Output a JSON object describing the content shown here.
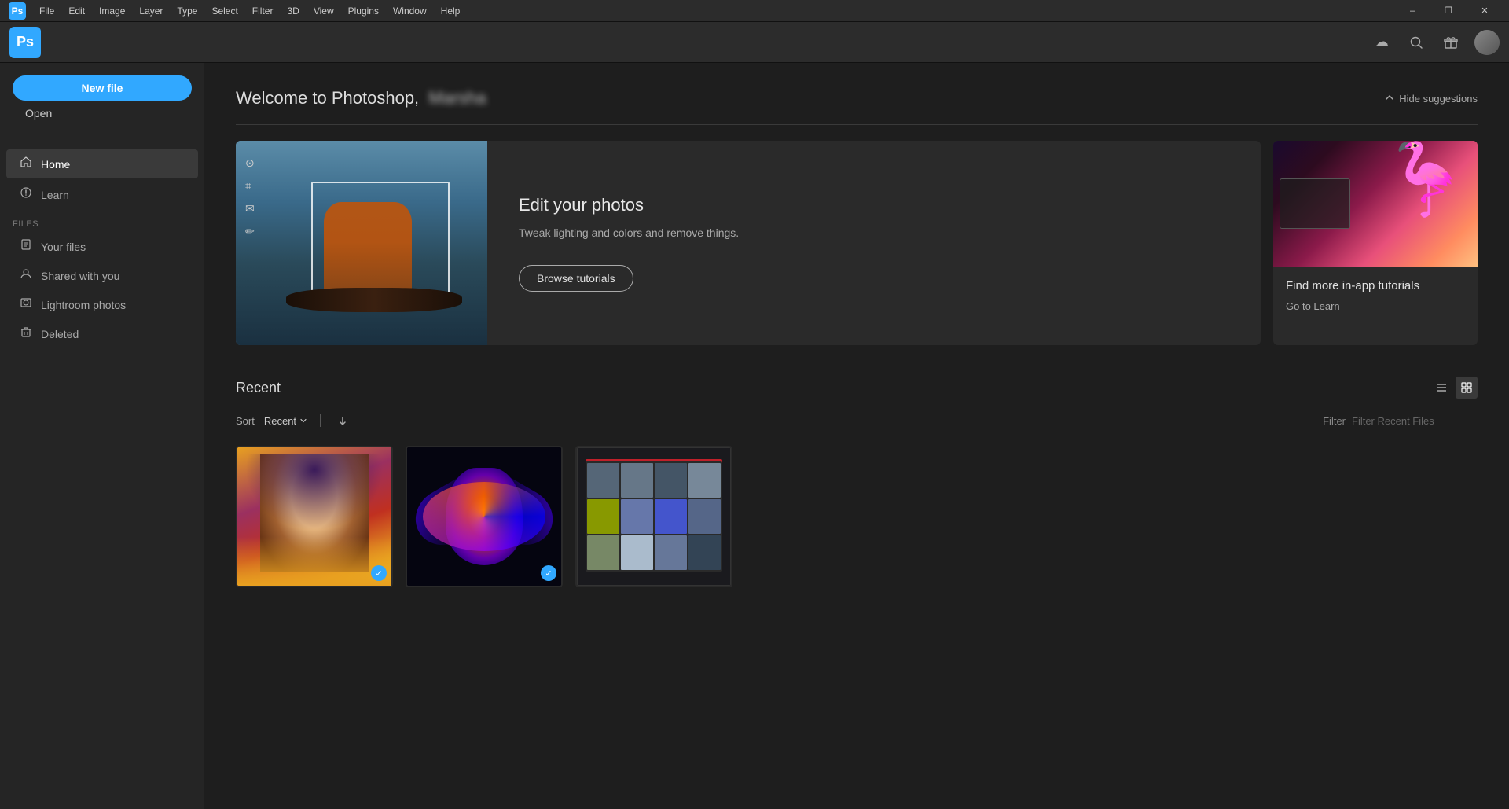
{
  "menubar": {
    "logo": "Ps",
    "items": [
      "File",
      "Edit",
      "Image",
      "Layer",
      "Type",
      "Select",
      "Filter",
      "3D",
      "View",
      "Plugins",
      "Window",
      "Help"
    ],
    "window_controls": [
      "–",
      "❐",
      "✕"
    ]
  },
  "topbar": {
    "logo": "Ps",
    "cloud_icon": "☁",
    "search_icon": "🔍",
    "gift_icon": "🎁"
  },
  "sidebar": {
    "new_file_label": "New file",
    "open_label": "Open",
    "nav_items": [
      {
        "id": "home",
        "label": "Home",
        "icon": "🏠",
        "active": true
      },
      {
        "id": "learn",
        "label": "Learn",
        "icon": "💡",
        "active": false
      }
    ],
    "files_section_label": "FILES",
    "file_items": [
      {
        "id": "your-files",
        "label": "Your files",
        "icon": "📄"
      },
      {
        "id": "shared",
        "label": "Shared with you",
        "icon": "👤"
      },
      {
        "id": "lightroom",
        "label": "Lightroom photos",
        "icon": "🖼"
      },
      {
        "id": "deleted",
        "label": "Deleted",
        "icon": "🗑"
      }
    ]
  },
  "welcome": {
    "title": "Welcome to Photoshop,",
    "username": "Marsha",
    "hide_suggestions": "Hide suggestions"
  },
  "suggestion_card": {
    "title": "Edit your photos",
    "description": "Tweak lighting and colors and remove things.",
    "button_label": "Browse tutorials"
  },
  "tutorials_card": {
    "title": "Find more in-app tutorials",
    "link_label": "Go to Learn"
  },
  "recent": {
    "title": "Recent",
    "sort_label": "Sort",
    "sort_option": "Recent",
    "filter_label": "Filter",
    "filter_placeholder": "Filter Recent Files"
  },
  "thumbnails": [
    {
      "id": "thumb-1",
      "has_check": true
    },
    {
      "id": "thumb-2",
      "has_check": true
    },
    {
      "id": "thumb-3",
      "has_check": false
    }
  ]
}
